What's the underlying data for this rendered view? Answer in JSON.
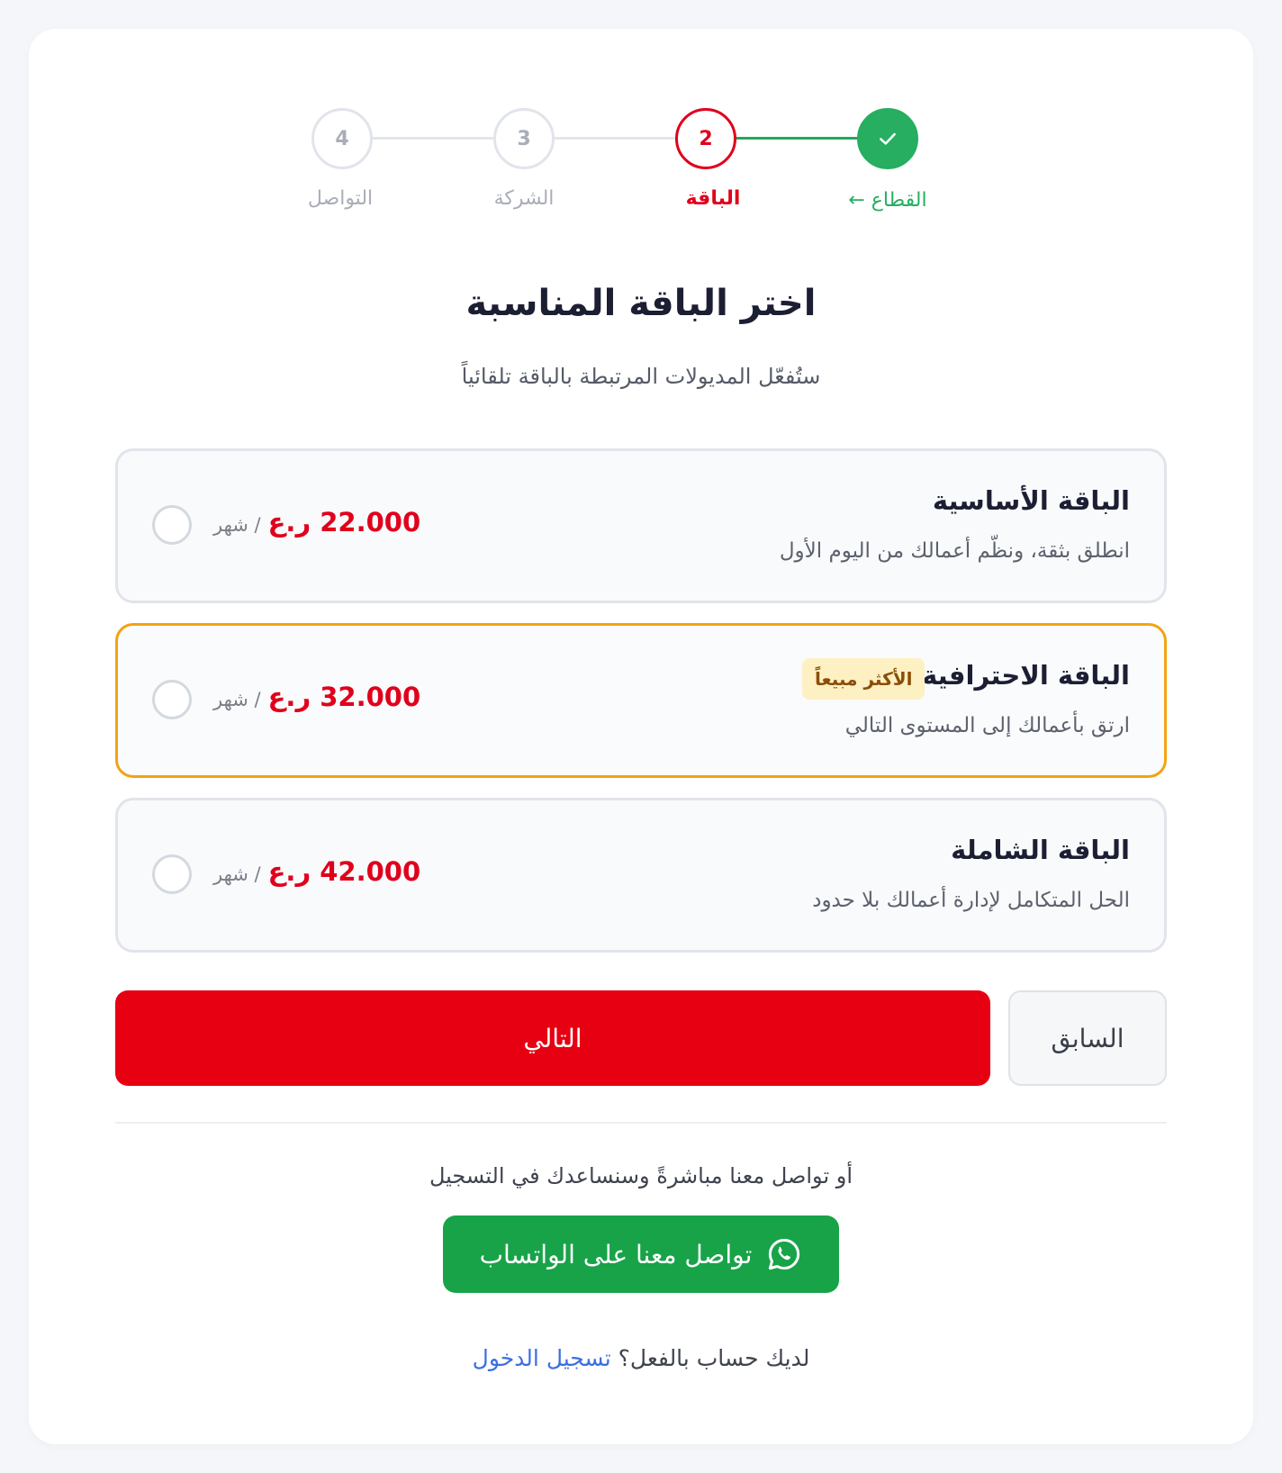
{
  "stepper": {
    "steps": [
      {
        "label": "القطاع ←",
        "number": "",
        "state": "done",
        "icon": "check-icon"
      },
      {
        "label": "الباقة",
        "number": "2",
        "state": "active"
      },
      {
        "label": "الشركة",
        "number": "3",
        "state": "pending"
      },
      {
        "label": "التواصل",
        "number": "4",
        "state": "pending"
      }
    ]
  },
  "header": {
    "title": "اختر الباقة المناسبة",
    "subtitle": "ستُفعّل المديولات المرتبطة بالباقة تلقائياً"
  },
  "plans": [
    {
      "name": "الباقة الأساسية",
      "description": "انطلق بثقة، ونظّم أعمالك من اليوم الأول",
      "price": "22.000 ر.ع",
      "period": "/ شهر",
      "badge": "",
      "selected": false
    },
    {
      "name": "الباقة الاحترافية",
      "description": "ارتق بأعمالك إلى المستوى التالي",
      "price": "32.000 ر.ع",
      "period": "/ شهر",
      "badge": "الأكثر مبيعاً",
      "selected": false
    },
    {
      "name": "الباقة الشاملة",
      "description": "الحل المتكامل لإدارة أعمالك بلا حدود",
      "price": "42.000 ر.ع",
      "period": "/ شهر",
      "badge": "",
      "selected": false
    }
  ],
  "actions": {
    "next_label": "التالي",
    "prev_label": "السابق"
  },
  "contact": {
    "text": "أو تواصل معنا مباشرةً وسنساعدك في التسجيل",
    "whatsapp_label": "تواصل معنا على الواتساب",
    "whatsapp_icon": "whatsapp-icon"
  },
  "login": {
    "prompt": "لديك حساب بالفعل؟",
    "link_label": "تسجيل الدخول"
  },
  "colors": {
    "accent_red": "#e60012",
    "success_green": "#27ae60",
    "whatsapp_green": "#18a349",
    "popular_border": "#f2a313",
    "link_blue": "#3d6fe0"
  }
}
